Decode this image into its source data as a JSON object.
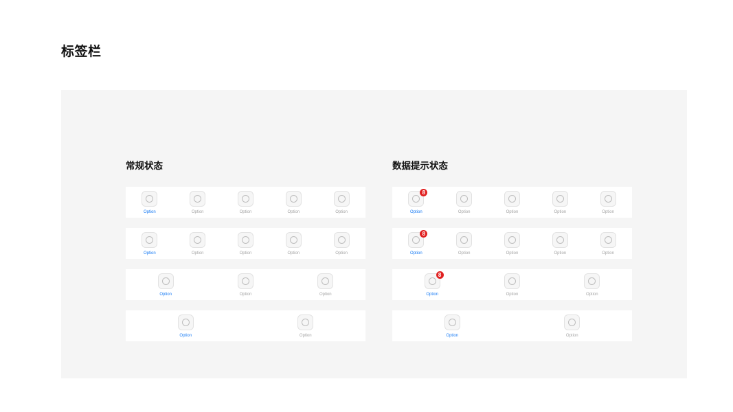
{
  "page": {
    "title": "标签栏"
  },
  "sections": {
    "normal": {
      "title": "常规状态",
      "bars": [
        {
          "tabs": [
            {
              "label": "Option",
              "active": true
            },
            {
              "label": "Option"
            },
            {
              "label": "Option"
            },
            {
              "label": "Option"
            },
            {
              "label": "Option"
            }
          ]
        },
        {
          "tabs": [
            {
              "label": "Option",
              "active": true
            },
            {
              "label": "Option"
            },
            {
              "label": "Option"
            },
            {
              "label": "Option"
            },
            {
              "label": "Option"
            }
          ]
        },
        {
          "tabs": [
            {
              "label": "Option",
              "active": true
            },
            {
              "label": "Option"
            },
            {
              "label": "Option"
            }
          ]
        },
        {
          "tabs": [
            {
              "label": "Option",
              "active": true
            },
            {
              "label": "Option"
            }
          ]
        }
      ]
    },
    "badge": {
      "title": "数据提示状态",
      "bars": [
        {
          "tabs": [
            {
              "label": "Option",
              "active": true,
              "badge": "8"
            },
            {
              "label": "Option"
            },
            {
              "label": "Option"
            },
            {
              "label": "Option"
            },
            {
              "label": "Option"
            }
          ]
        },
        {
          "tabs": [
            {
              "label": "Option",
              "active": true,
              "badge": "8"
            },
            {
              "label": "Option"
            },
            {
              "label": "Option"
            },
            {
              "label": "Option"
            },
            {
              "label": "Option"
            }
          ]
        },
        {
          "tabs": [
            {
              "label": "Option",
              "active": true,
              "badge": "8"
            },
            {
              "label": "Option"
            },
            {
              "label": "Option"
            }
          ]
        },
        {
          "tabs": [
            {
              "label": "Option",
              "active": true
            },
            {
              "label": "Option"
            }
          ]
        }
      ]
    }
  },
  "colors": {
    "active": "#1a7cf4",
    "inactive": "#a5a5a5",
    "badge": "#e02020",
    "panel": "#f5f5f5"
  },
  "icons": {
    "tab": "circle-placeholder-icon"
  }
}
